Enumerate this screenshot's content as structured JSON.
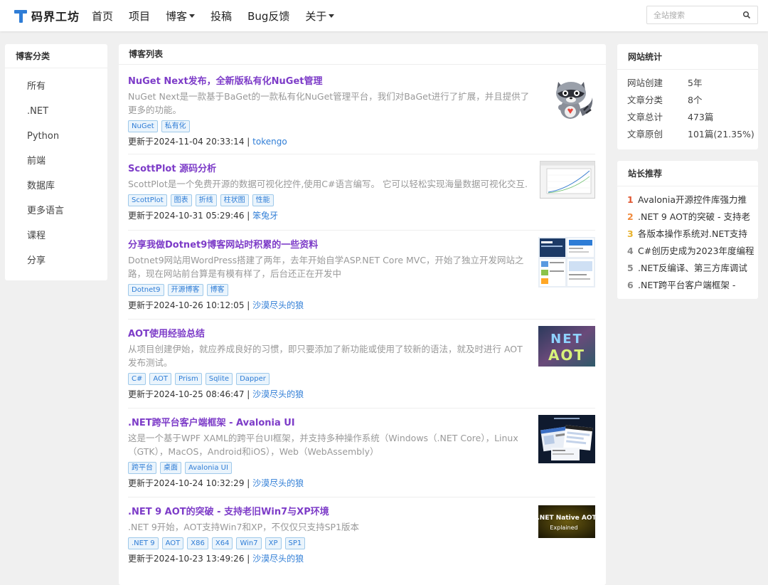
{
  "header": {
    "logo_text": "码界工坊",
    "nav": [
      {
        "label": "首页",
        "dropdown": false
      },
      {
        "label": "项目",
        "dropdown": false
      },
      {
        "label": "博客",
        "dropdown": true
      },
      {
        "label": "投稿",
        "dropdown": false
      },
      {
        "label": "Bug反馈",
        "dropdown": false
      },
      {
        "label": "关于",
        "dropdown": true
      }
    ],
    "search_placeholder": "全站搜索"
  },
  "categories": {
    "title": "博客分类",
    "items": [
      "所有",
      ".NET",
      "Python",
      "前端",
      "数据库",
      "更多语言",
      "课程",
      "分享"
    ]
  },
  "blog": {
    "title": "博客列表",
    "posts": [
      {
        "title": "NuGet Next发布，全新版私有化NuGet管理",
        "summary": "NuGet Next是一款基于BaGet的一款私有化NuGet管理平台，我们对BaGet进行了扩展，并且提供了更多的功能。",
        "tags": [
          "NuGet",
          "私有化"
        ],
        "updated": "更新于2024-11-04 20:33:14 |",
        "author": "tokengo",
        "thumb": "raccoon-mascot"
      },
      {
        "title": "ScottPlot 源码分析",
        "summary": "ScottPlot是一个免费开源的数据可视化控件,使用C#语言编写。 它可以轻松实现海量数据可视化交互.",
        "tags": [
          "ScottPlot",
          "图表",
          "折线",
          "柱状图",
          "性能"
        ],
        "updated": "更新于2024-10-31 05:29:46 |",
        "author": "笨兔牙",
        "thumb": "line-plot"
      },
      {
        "title": "分享我做Dotnet9博客网站时积累的一些资料",
        "summary": "Dotnet9网站用WordPress搭建了两年，去年开始自学ASP.NET Core MVC，开始了独立开发网站之路，现在网站前台算是有模有样了，后台还正在开发中",
        "tags": [
          "Dotnet9",
          "开源博客",
          "博客"
        ],
        "updated": "更新于2024-10-26 10:12:05 |",
        "author": "沙漠尽头的狼",
        "thumb": "website-screens"
      },
      {
        "title": "AOT使用经验总结",
        "summary": "从项目创建伊始，就应养成良好的习惯，即只要添加了新功能或使用了较新的语法，就及时进行 AOT 发布测试。",
        "tags": [
          "C#",
          "AOT",
          "Prism",
          "Sqlite",
          "Dapper"
        ],
        "updated": "更新于2024-10-25 08:46:47 |",
        "author": "沙漠尽头的狼",
        "thumb": "net-aot"
      },
      {
        "title": ".NET跨平台客户端框架 - Avalonia UI",
        "summary": "这是一个基于WPF XAML的跨平台UI框架，并支持多种操作系统（Windows（.NET Core），Linux（GTK），MacOS，Android和iOS），Web（WebAssembly）",
        "tags": [
          "跨平台",
          "桌面",
          "Avalonia UI"
        ],
        "updated": "更新于2024-10-24 10:32:29 |",
        "author": "沙漠尽头的狼",
        "thumb": "avalonia-screens"
      },
      {
        "title": ".NET 9 AOT的突破 - 支持老旧Win7与XP环境",
        "summary": ".NET 9开始，AOT支持Win7和XP，不仅仅只支持SP1版本",
        "tags": [
          ".NET 9",
          "AOT",
          "X86",
          "X64",
          "Win7",
          "XP",
          "SP1"
        ],
        "updated": "更新于2024-10-23 13:49:26 |",
        "author": "沙漠尽头的狼",
        "thumb": "net-native-aot",
        "thumb_text": [
          ".NET Native AOT",
          "Explained"
        ]
      }
    ]
  },
  "stats": {
    "title": "网站统计",
    "rows": [
      {
        "k": "网站创建",
        "v": "5年"
      },
      {
        "k": "文章分类",
        "v": "8个"
      },
      {
        "k": "文章总计",
        "v": "473篇"
      },
      {
        "k": "文章原创",
        "v": "101篇(21.35%)"
      }
    ]
  },
  "recommend": {
    "title": "站长推荐",
    "items": [
      {
        "num": "1",
        "text": "Avalonia开源控件库强力推",
        "color": "#e0552f"
      },
      {
        "num": "2",
        "text": ".NET 9 AOT的突破 - 支持老",
        "color": "#f08a3c"
      },
      {
        "num": "3",
        "text": "各版本操作系统对.NET支持",
        "color": "#e8b22c"
      },
      {
        "num": "4",
        "text": "C#创历史成为2023年度编程",
        "color": "#888888"
      },
      {
        "num": "5",
        "text": ".NET反编译、第三方库调试",
        "color": "#888888"
      },
      {
        "num": "6",
        "text": ".NET跨平台客户端框架 -",
        "color": "#888888"
      }
    ]
  }
}
